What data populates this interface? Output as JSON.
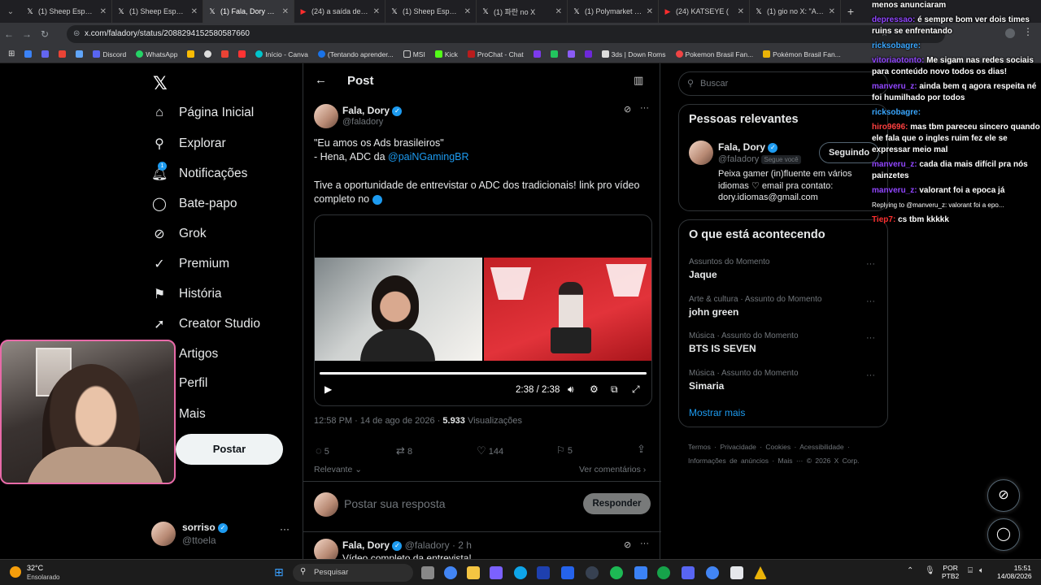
{
  "tabs": [
    {
      "label": "(1) Sheep Esports",
      "active": false
    },
    {
      "label": "(1) Sheep Esports",
      "active": false
    },
    {
      "label": "(1) Fala, Dory no X",
      "active": true
    },
    {
      "label": "(24) a saída de xe",
      "active": false
    },
    {
      "label": "(1) Sheep Esports",
      "active": false
    },
    {
      "label": "(1) 파란 no X",
      "active": false
    },
    {
      "label": "(1) Polymarket Le",
      "active": false
    },
    {
      "label": "(24) KATSEYE (",
      "active": false
    },
    {
      "label": "(1) gio no X: \"Al C",
      "active": false
    }
  ],
  "address": {
    "url": "x.com/faladory/status/2088294152580587660"
  },
  "bookmarks": [
    "Discord",
    "WhatsApp",
    "Início - Canva",
    "(Tentando aprender...",
    "MSI",
    "Kick",
    "ProChat - Chat",
    "3ds | Down Roms",
    "Pokemon Brasil Fan...",
    "Pokémon Brasil Fan..."
  ],
  "nav": {
    "home": "Página Inicial",
    "explore": "Explorar",
    "notifications": "Notificações",
    "notif_badge": "1",
    "chat": "Bate-papo",
    "grok": "Grok",
    "premium": "Premium",
    "history": "História",
    "creator": "Creator Studio",
    "articles": "Artigos",
    "profile": "Perfil",
    "more": "Mais",
    "post_button": "Postar"
  },
  "me": {
    "name": "sorriso",
    "handle": "@ttoela"
  },
  "header": {
    "title": "Post"
  },
  "post": {
    "author": "Fala, Dory",
    "handle": "@faladory",
    "line1": "\"Eu amos os Ads brasileiros\"",
    "line2_prefix": "- Hena, ADC da ",
    "line2_mention": "@paiNGamingBR",
    "line3": "Tive a oportunidade de entrevistar o ADC dos tradicionais! link pro vídeo completo no",
    "video_time": "2:38 / 2:38",
    "video_progress": 1.0,
    "timestamp": "12:58 PM · 14 de ago de 2026 · ",
    "views": "5.933",
    "views_label": " Visualizações",
    "replies": "5",
    "reposts": "8",
    "likes": "144",
    "bookmarks": "5",
    "sort": "Relevante",
    "see_comments": "Ver comentários",
    "reply_placeholder": "Postar sua resposta",
    "reply_button": "Responder"
  },
  "reply": {
    "author": "Fala, Dory",
    "handle": "@faladory",
    "time": "2 h",
    "text": "Vídeo completo da entrevista!"
  },
  "search": {
    "placeholder": "Buscar"
  },
  "relevant": {
    "title": "Pessoas relevantes",
    "name": "Fala, Dory",
    "handle": "@faladory",
    "follows_you": "Segue você",
    "button": "Seguindo",
    "bio": "Peixa gamer (in)fluente em vários idiomas ♡ email pra contato: dory.idiomas@gmail.com"
  },
  "trends": {
    "title": "O que está acontecendo",
    "items": [
      {
        "context": "Assuntos do Momento",
        "name": "Jaque"
      },
      {
        "context": "Arte & cultura · Assunto do Momento",
        "name": "john green"
      },
      {
        "context": "Música · Assunto do Momento",
        "name": "BTS IS SEVEN"
      },
      {
        "context": "Música · Assunto do Momento",
        "name": "Simaria"
      }
    ],
    "show_more": "Mostrar mais"
  },
  "footer": [
    "Termos",
    "Privacidade",
    "Cookies",
    "Acessibilidade",
    "Informações de anúncios",
    "Mais ···",
    "© 2026 X Corp."
  ],
  "chat": [
    {
      "user": "",
      "text": "menos anunciaram",
      "color": "#ffffff"
    },
    {
      "user": "depressao:",
      "text": "é sempre bom ver dois times ruins se enfrentando",
      "color": "#9146ff"
    },
    {
      "user": "ricksobagre:",
      "text": "",
      "color": "#3aa7ff"
    },
    {
      "user": "vitoriaotonto:",
      "text": "Me sigam nas redes sociais para conteúdo novo todos os dias!",
      "color": "#9146ff"
    },
    {
      "user": "manveru_z:",
      "text": "ainda bem q agora respeita né foi humilhado por todos",
      "color": "#9146ff"
    },
    {
      "user": "ricksobagre:",
      "text": "",
      "color": "#3aa7ff"
    },
    {
      "user": "hiro9696:",
      "text": "mas tbm pareceu sincero quando ele fala que o ingles ruim fez ele se expressar meio mal",
      "color": "#ff4040"
    },
    {
      "user": "manveru_z:",
      "text": "cada dia mais difícil pra nós painzetes",
      "color": "#9146ff"
    },
    {
      "user": "manveru_z:",
      "text": "valorant foi a epoca já",
      "color": "#9146ff"
    },
    {
      "user": "",
      "text": "Replying to @manveru_z: valorant foi a epo...",
      "color": "#aaaaaa"
    },
    {
      "user": "Tiep7:",
      "text": "cs tbm kkkkk",
      "color": "#ff3030"
    }
  ],
  "taskbar": {
    "weather_temp": "32°C",
    "weather_desc": "Ensolarado",
    "search": "Pesquisar",
    "lang1": "POR",
    "lang2": "PTB2",
    "time": "15:51",
    "date": "14/08/2026"
  },
  "colors": {
    "accent": "#1d9bf0",
    "background": "#000000",
    "webcam_border": "#e86aa8"
  }
}
